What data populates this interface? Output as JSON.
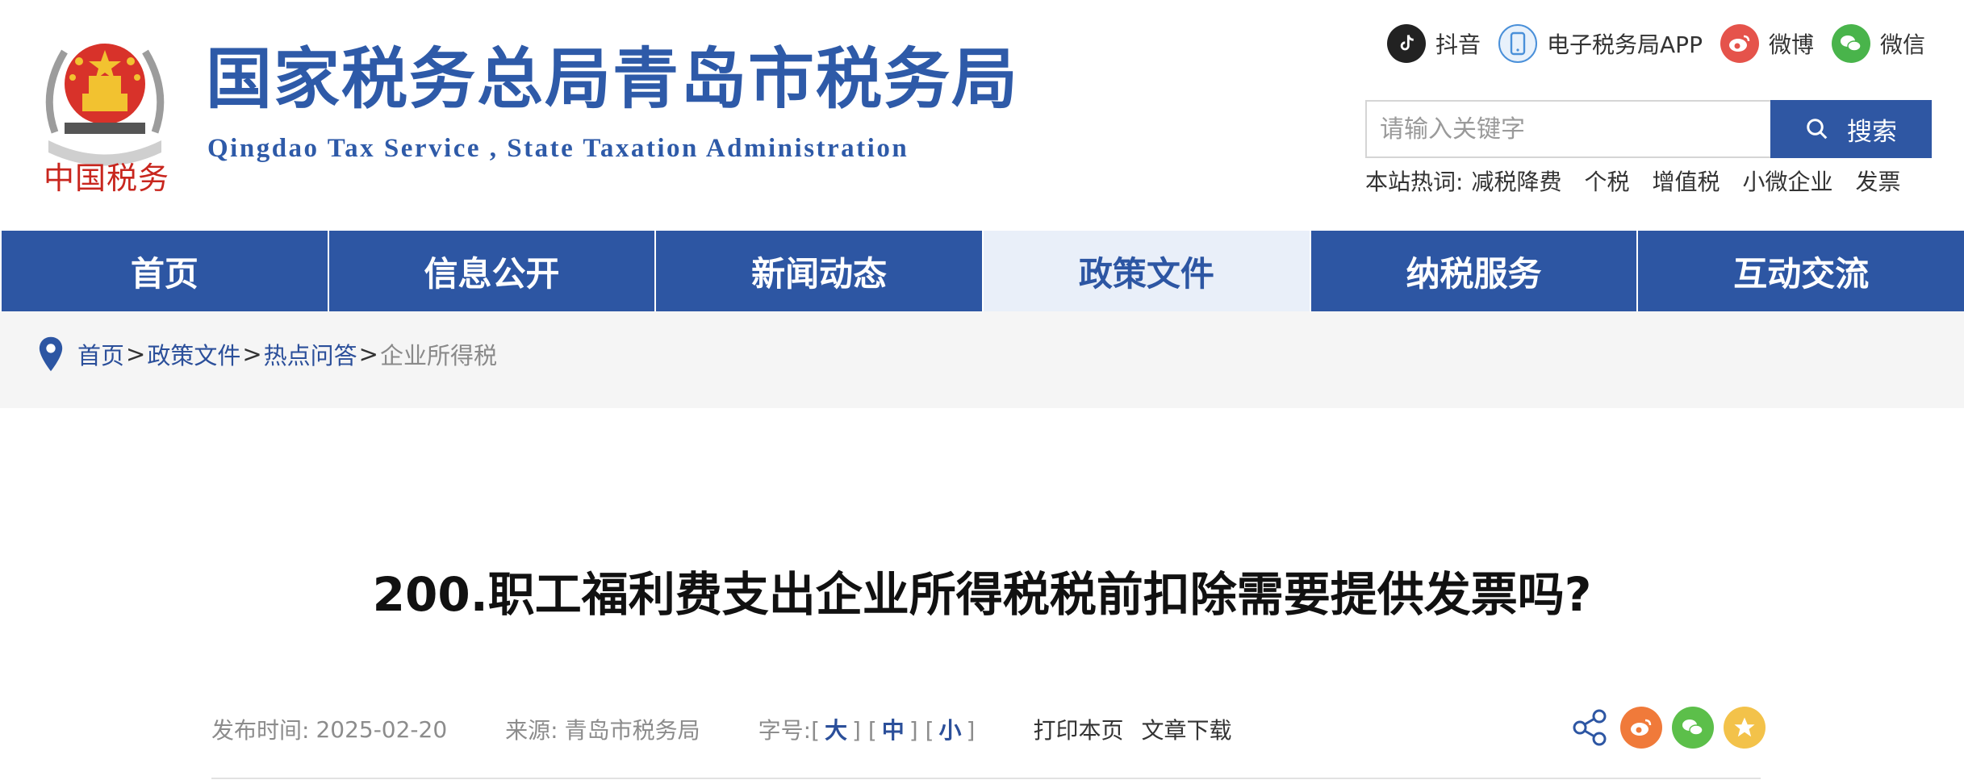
{
  "header": {
    "emblem_text": "中国税务",
    "title": "国家税务总局青岛市税务局",
    "subtitle": "Qingdao Tax Service , State Taxation Administration",
    "social": [
      {
        "label": "抖音",
        "icon": "douyin-icon",
        "color": "#222222"
      },
      {
        "label": "电子税务局APP",
        "icon": "mobile-app-icon",
        "color": "#4a90d9"
      },
      {
        "label": "微博",
        "icon": "weibo-icon",
        "color": "#e5534b"
      },
      {
        "label": "微信",
        "icon": "wechat-icon",
        "color": "#49b44b"
      }
    ],
    "search": {
      "placeholder": "请输入关键字",
      "button_label": "搜索"
    },
    "hotwords": {
      "label": "本站热词:",
      "words": [
        "减税降费",
        "个税",
        "增值税",
        "小微企业",
        "发票"
      ]
    }
  },
  "nav": {
    "items": [
      {
        "label": "首页"
      },
      {
        "label": "信息公开"
      },
      {
        "label": "新闻动态"
      },
      {
        "label": "政策文件",
        "active": true
      },
      {
        "label": "纳税服务"
      },
      {
        "label": "互动交流"
      }
    ]
  },
  "breadcrumb": {
    "items": [
      "首页",
      "政策文件",
      "热点问答"
    ],
    "separator": ">",
    "current": "企业所得税"
  },
  "article": {
    "title": "200.职工福利费支出企业所得税税前扣除需要提供发票吗?",
    "publish_label": "发布时间:",
    "publish_date": "2025-02-20",
    "source_label": "来源:",
    "source": "青岛市税务局",
    "font_size": {
      "label": "字号:",
      "large": "大",
      "medium": "中",
      "small": "小"
    },
    "print_label": "打印本页",
    "download_label": "文章下载",
    "share_icons": [
      "share-icon",
      "weibo-icon",
      "wechat-icon",
      "favorite-icon"
    ]
  },
  "colors": {
    "brand_blue": "#2d56a3",
    "nav_active_bg": "#e9eff9",
    "crumb_bg": "#f5f5f5",
    "share_weibo": "#f07a3a",
    "share_wechat": "#5cbf4a",
    "share_favorite": "#f3c24a"
  }
}
